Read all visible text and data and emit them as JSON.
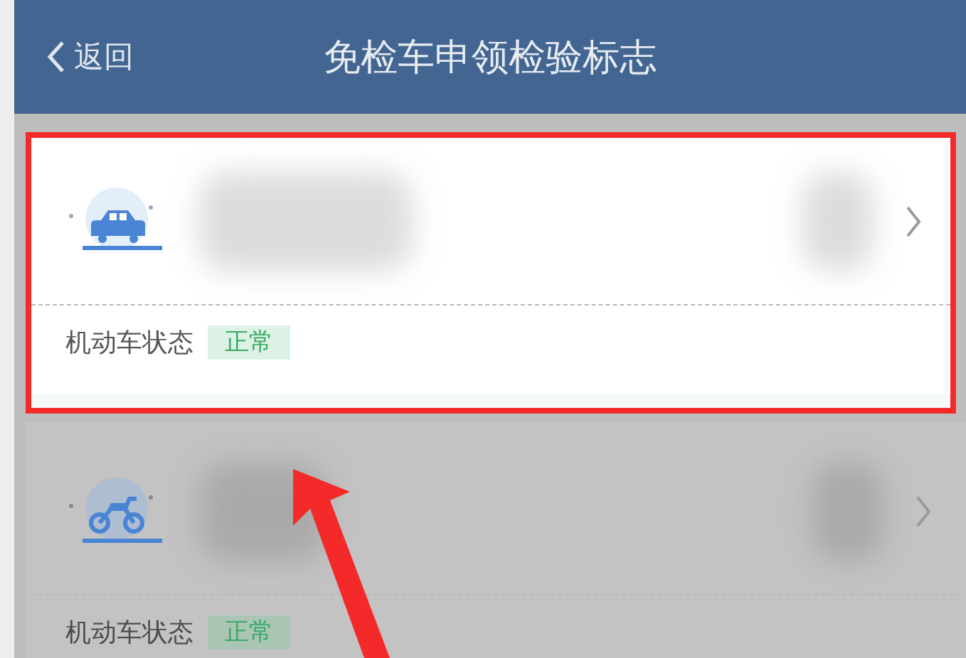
{
  "header": {
    "back_label": "返回",
    "title": "免检车申领检验标志"
  },
  "vehicles": [
    {
      "kind": "car",
      "status_label": "机动车状态",
      "status_value": "正常",
      "highlighted": true,
      "dimmed": false
    },
    {
      "kind": "motorcycle",
      "status_label": "机动车状态",
      "status_value": "正常",
      "highlighted": false,
      "dimmed": true
    }
  ],
  "annotation": {
    "kind": "arrow"
  }
}
